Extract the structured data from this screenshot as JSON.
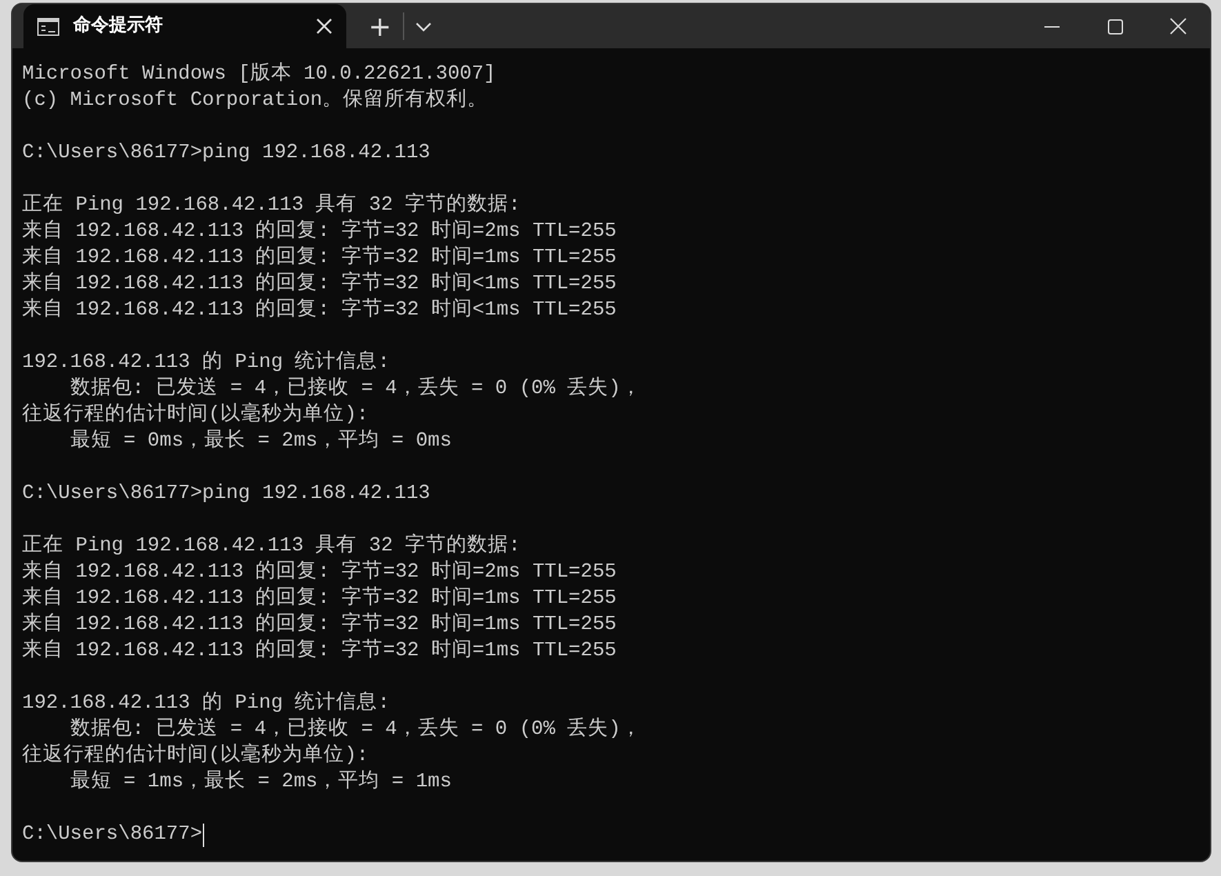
{
  "tabs": [
    {
      "title": "命令提示符",
      "selected": true
    }
  ],
  "new_tab_symbol": "+",
  "terminal": {
    "blocks": [
      [
        "Microsoft Windows [版本 10.0.22621.3007]",
        "(c) Microsoft Corporation。保留所有权利。"
      ],
      [
        "C:\\Users\\86177>ping 192.168.42.113"
      ],
      [
        "正在 Ping 192.168.42.113 具有 32 字节的数据:",
        "来自 192.168.42.113 的回复: 字节=32 时间=2ms TTL=255",
        "来自 192.168.42.113 的回复: 字节=32 时间=1ms TTL=255",
        "来自 192.168.42.113 的回复: 字节=32 时间<1ms TTL=255",
        "来自 192.168.42.113 的回复: 字节=32 时间<1ms TTL=255"
      ],
      [
        "192.168.42.113 的 Ping 统计信息:",
        "    数据包: 已发送 = 4，已接收 = 4，丢失 = 0 (0% 丢失)，",
        "往返行程的估计时间(以毫秒为单位):",
        "    最短 = 0ms，最长 = 2ms，平均 = 0ms"
      ],
      [
        "C:\\Users\\86177>ping 192.168.42.113"
      ],
      [
        "正在 Ping 192.168.42.113 具有 32 字节的数据:",
        "来自 192.168.42.113 的回复: 字节=32 时间=2ms TTL=255",
        "来自 192.168.42.113 的回复: 字节=32 时间=1ms TTL=255",
        "来自 192.168.42.113 的回复: 字节=32 时间=1ms TTL=255",
        "来自 192.168.42.113 的回复: 字节=32 时间=1ms TTL=255"
      ],
      [
        "192.168.42.113 的 Ping 统计信息:",
        "    数据包: 已发送 = 4，已接收 = 4，丢失 = 0 (0% 丢失)，",
        "往返行程的估计时间(以毫秒为单位):",
        "    最短 = 1ms，最长 = 2ms，平均 = 1ms"
      ]
    ],
    "prompt": {
      "text": "C:\\Users\\86177>",
      "cursor": true
    }
  }
}
